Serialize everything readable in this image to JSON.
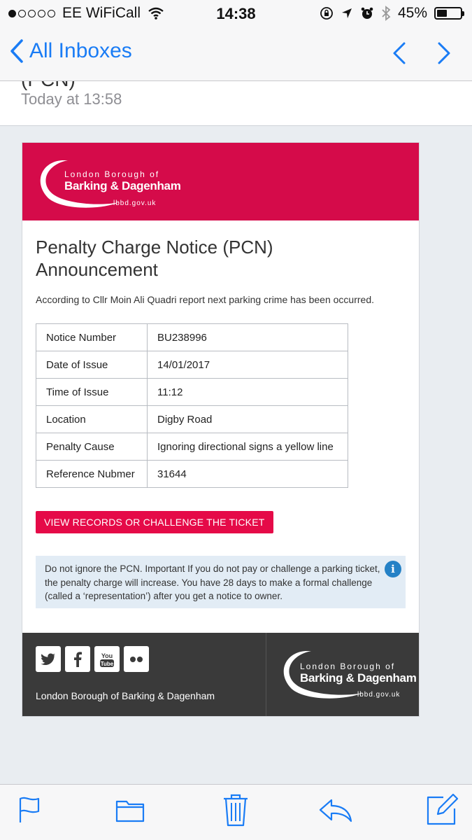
{
  "status_bar": {
    "carrier": "EE WiFiCall",
    "time": "14:38",
    "battery": "45%",
    "battery_level": 0.45,
    "signal_bars": 1
  },
  "nav": {
    "back_label": "All Inboxes"
  },
  "message_header": {
    "subject_fragment": "(PCN)",
    "date": "Today at 13:58"
  },
  "email": {
    "brand": {
      "line1": "London Borough of",
      "line2": "Barking & Dagenham",
      "site": "lbbd.gov.uk",
      "color": "#d50b4a"
    },
    "title": "Penalty Charge Notice (PCN) Announcement",
    "intro": "According to Cllr Moin Ali Quadri report next parking crime has been occurred.",
    "table": [
      {
        "label": "Notice Number",
        "value": "BU238996"
      },
      {
        "label": "Date of Issue",
        "value": "14/01/2017"
      },
      {
        "label": "Time of Issue",
        "value": "11:12"
      },
      {
        "label": "Location",
        "value": "Digby Road"
      },
      {
        "label": "Penalty Cause",
        "value": "Ignoring directional signs a yellow line"
      },
      {
        "label": "Reference Nubmer",
        "value": "31644"
      }
    ],
    "cta_label": "VIEW RECORDS OR CHALLENGE THE TICKET",
    "notice_text": "Do not ignore the PCN. Important If you do not pay or challenge a parking ticket, the penalty charge will increase. You have 28 days to make a formal challenge (called a ‘representation’) after you get a notice to owner.",
    "footer": {
      "name": "London Borough of Barking & Dagenham",
      "social": [
        "twitter-icon",
        "facebook-icon",
        "youtube-icon",
        "flickr-icon"
      ]
    }
  },
  "toolbar": [
    "flag-icon",
    "folder-icon",
    "trash-icon",
    "reply-icon",
    "compose-icon"
  ]
}
